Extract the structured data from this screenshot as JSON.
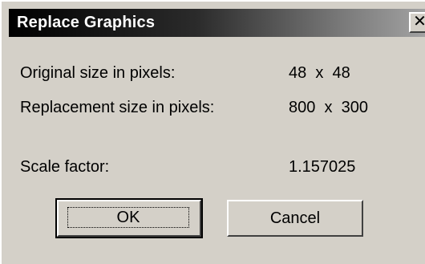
{
  "dialog": {
    "title": "Replace Graphics",
    "close_glyph": "✕"
  },
  "rows": {
    "original_label": "Original size in pixels:",
    "original_value": "48  x  48",
    "replacement_label": "Replacement size in pixels:",
    "replacement_value": "800  x  300",
    "scale_label": "Scale factor:",
    "scale_value": "1.157025"
  },
  "buttons": {
    "ok_label": "OK",
    "cancel_label": "Cancel"
  },
  "colors": {
    "dialog_face": "#d4d0c8",
    "title_text": "#ffffff",
    "title_gradient_start": "#000000",
    "title_gradient_end": "#a3a3a3"
  }
}
